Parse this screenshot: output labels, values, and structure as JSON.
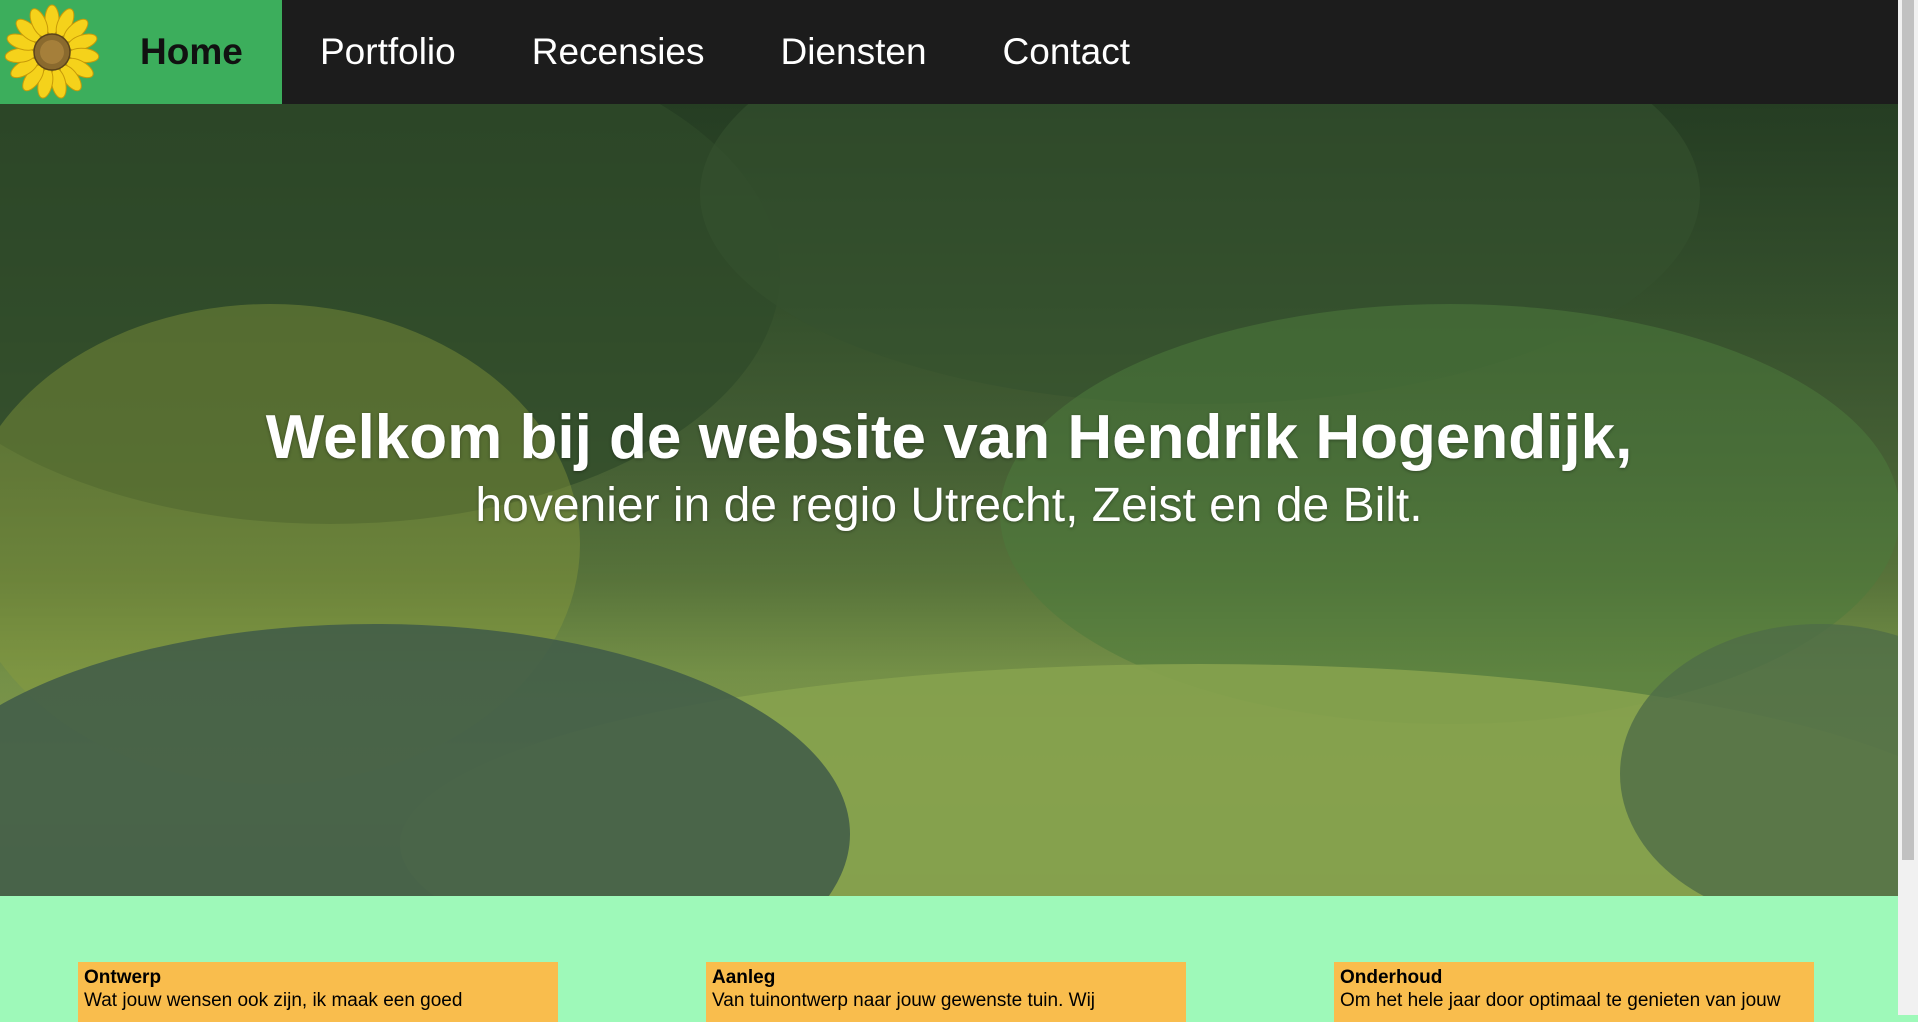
{
  "nav": {
    "home_label": "Home",
    "items": [
      {
        "label": "Portfolio"
      },
      {
        "label": "Recensies"
      },
      {
        "label": "Diensten"
      },
      {
        "label": "Contact"
      }
    ],
    "logo_icon": "sunflower-icon",
    "colors": {
      "bar": "#1c1c1c",
      "home_bg": "#3cae5c"
    }
  },
  "hero": {
    "title": "Welkom bij de website van Hendrik Hogendijk,",
    "subtitle": "hovenier in de regio Utrecht, Zeist en de Bilt."
  },
  "cards": [
    {
      "title": "Ontwerp",
      "text": "Wat jouw wensen ook zijn, ik maak een goed"
    },
    {
      "title": "Aanleg",
      "text": "Van tuinontwerp naar jouw gewenste tuin. Wij"
    },
    {
      "title": "Onderhoud",
      "text": "Om het hele jaar door optimaal te genieten van jouw"
    }
  ],
  "colors": {
    "page_bg": "#9ef9b9",
    "card_bg": "#f9bd4d"
  }
}
